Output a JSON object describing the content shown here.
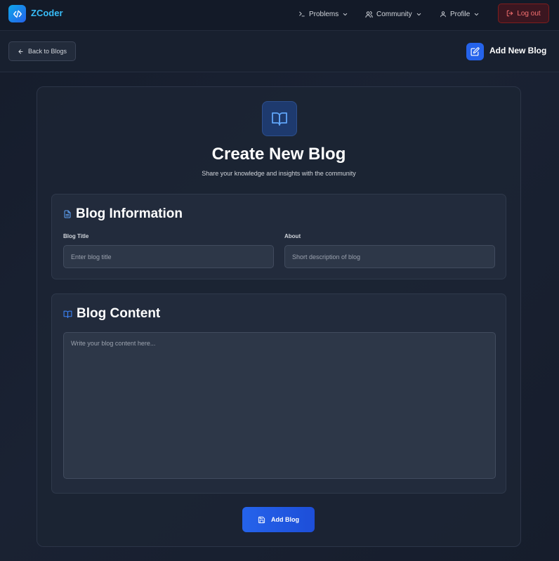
{
  "app": {
    "name": "ZCoder"
  },
  "nav": {
    "items": [
      {
        "label": "Problems",
        "icon": "terminal-icon"
      },
      {
        "label": "Community",
        "icon": "users-icon"
      },
      {
        "label": "Profile",
        "icon": "user-icon"
      }
    ],
    "logout_label": "Log out"
  },
  "subheader": {
    "back_label": "Back to Blogs",
    "title": "Add New Blog"
  },
  "hero": {
    "title": "Create New Blog",
    "subtitle": "Share your knowledge and insights with the community"
  },
  "blog_info": {
    "heading": "Blog Information",
    "title_label": "Blog Title",
    "title_placeholder": "Enter blog title",
    "title_value": "",
    "about_label": "About",
    "about_placeholder": "Short description of blog",
    "about_value": ""
  },
  "blog_content": {
    "heading": "Blog Content",
    "placeholder": "Write your blog content here...",
    "value": ""
  },
  "submit": {
    "label": "Add Blog"
  },
  "colors": {
    "accent": "#2563eb",
    "logo": "#38bdf8",
    "danger": "#f87171",
    "background": "#1a2233"
  }
}
